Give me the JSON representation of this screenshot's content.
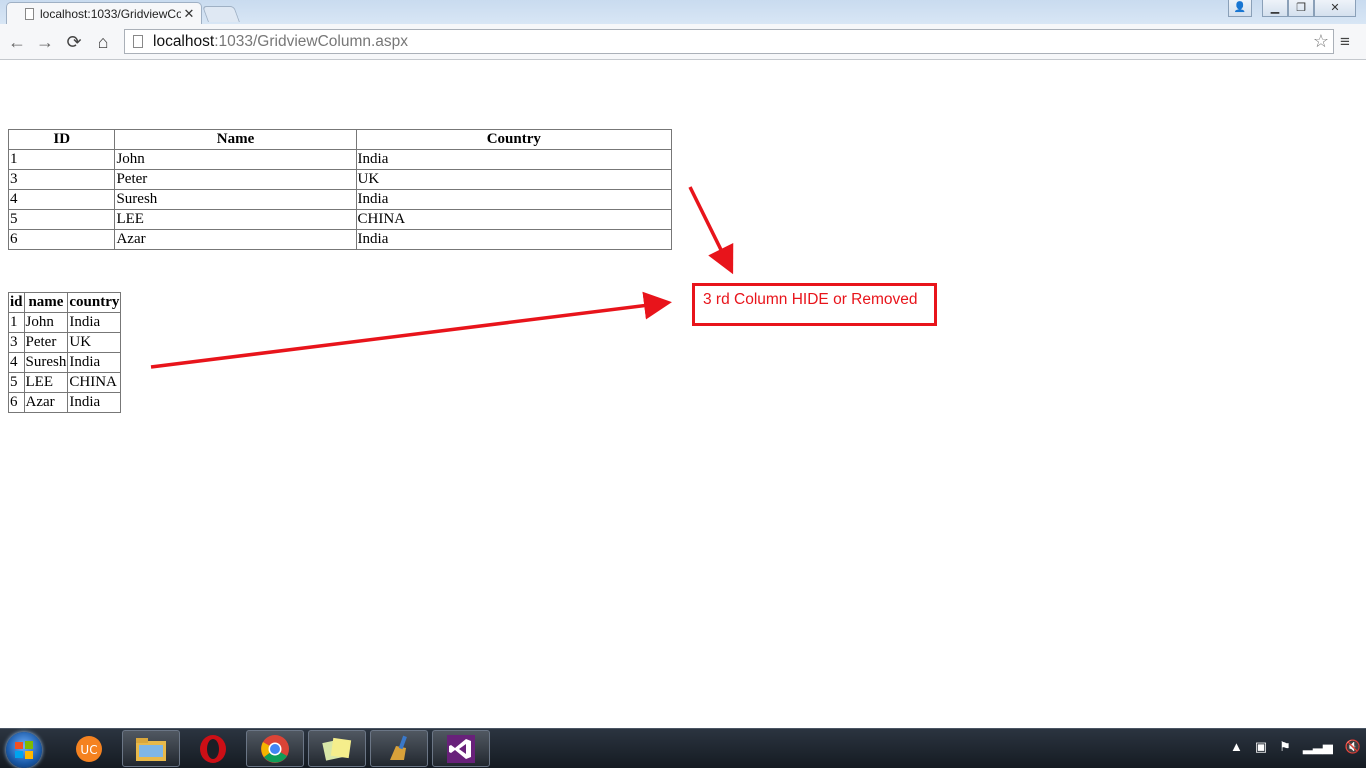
{
  "browser": {
    "tab_title": "localhost:1033/GridviewCo",
    "tab_close": "✕",
    "url_host": "localhost",
    "url_path": ":1033/GridviewColumn.aspx",
    "back": "←",
    "forward": "→",
    "reload": "⟳",
    "home": "⌂",
    "star": "☆",
    "menu": "≡",
    "minimize": "▁",
    "restore": "❐",
    "close": "✕",
    "user": "👤"
  },
  "grid1": {
    "headers": [
      "ID",
      "Name",
      "Country"
    ],
    "rows": [
      [
        "1",
        "John",
        "India"
      ],
      [
        "3",
        "Peter",
        "UK"
      ],
      [
        "4",
        "Suresh",
        "India"
      ],
      [
        "5",
        "LEE",
        "CHINA"
      ],
      [
        "6",
        "Azar",
        "India"
      ]
    ]
  },
  "grid2": {
    "headers": [
      "id",
      "name",
      "country"
    ],
    "rows": [
      [
        "1",
        "John",
        "India"
      ],
      [
        "3",
        "Peter",
        "UK"
      ],
      [
        "4",
        "Suresh",
        "India"
      ],
      [
        "5",
        "LEE",
        "CHINA"
      ],
      [
        "6",
        "Azar",
        "India"
      ]
    ]
  },
  "annotation": {
    "text": "3 rd Column HIDE or Removed",
    "color": "#e8141b"
  },
  "taskbar": {
    "apps": [
      "uc-browser-icon",
      "file-explorer-icon",
      "opera-icon",
      "chrome-icon",
      "sticky-notes-icon",
      "ccleaner-icon",
      "visual-studio-icon"
    ]
  }
}
